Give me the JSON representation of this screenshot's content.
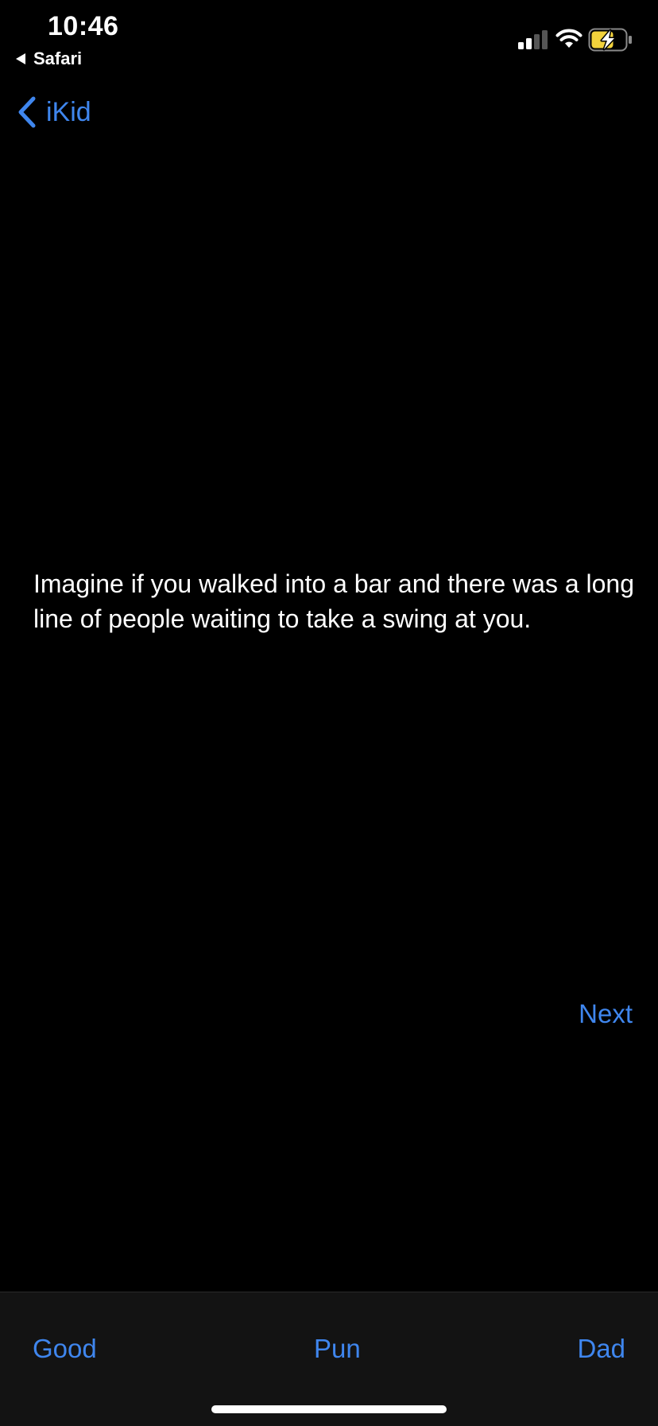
{
  "status_bar": {
    "time": "10:46",
    "back_app_label": "Safari",
    "icons": [
      "cellular-signal-icon",
      "wifi-icon",
      "battery-charging-icon"
    ],
    "battery_color": "#f2d23c"
  },
  "nav": {
    "back_label": "iKid"
  },
  "main": {
    "joke_text": "Imagine if you walked into a bar and there was a long line of people waiting to take a swing at you.",
    "next_label": "Next"
  },
  "tab_bar": {
    "tabs": [
      {
        "label": "Good"
      },
      {
        "label": "Pun"
      },
      {
        "label": "Dad"
      }
    ]
  },
  "colors": {
    "accent": "#3f86ee",
    "background": "#000000",
    "tab_bar_background": "#131313"
  }
}
